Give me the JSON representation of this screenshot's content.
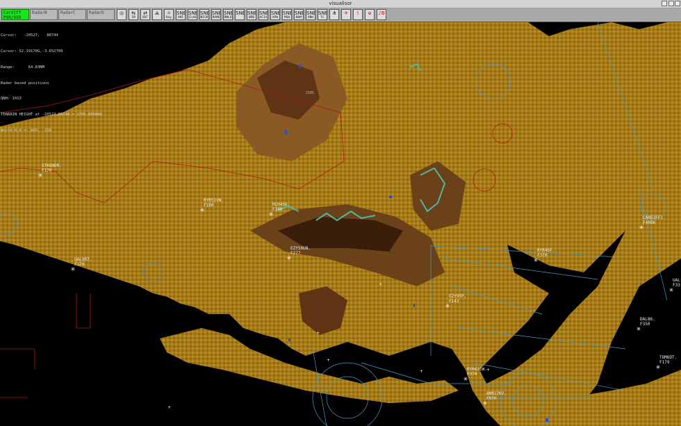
{
  "window": {
    "title": "visualisor"
  },
  "radar_tabs": [
    {
      "label": "Cardiff PSR/SSR",
      "active": true
    },
    {
      "label": "RadarB",
      "active": false
    },
    {
      "label": "RadarC",
      "active": false
    },
    {
      "label": "RadarD",
      "active": false
    }
  ],
  "tools": [
    {
      "label": "",
      "icon": "◎"
    },
    {
      "label": "IN",
      "icon": "⇆"
    },
    {
      "label": "OUT",
      "icon": "⇄"
    },
    {
      "label": "",
      "icon": "⟁"
    },
    {
      "label": "Day",
      "icon": "☼"
    },
    {
      "label": "AMI",
      "icon": "SNET"
    },
    {
      "label": "CLAU",
      "icon": "SNET"
    },
    {
      "label": "NIGR",
      "icon": "SNET"
    },
    {
      "label": "RAMD",
      "icon": "SNET"
    },
    {
      "label": "RMLD",
      "icon": "SNET"
    },
    {
      "label": "",
      "icon": "SNET"
    },
    {
      "label": "WRB",
      "icon": "SNET"
    },
    {
      "label": "AFIA",
      "icon": "SNET"
    },
    {
      "label": "APW",
      "icon": "SNET"
    },
    {
      "label": "MSW",
      "icon": "SNET"
    },
    {
      "label": "NAM",
      "icon": "SNET"
    },
    {
      "label": "ONH",
      "icon": "SNET"
    },
    {
      "label": "TC",
      "icon": "SNET"
    },
    {
      "label": "",
      "icon": "⋔"
    },
    {
      "label": "",
      "icon": "✈"
    },
    {
      "label": "",
      "icon": "⌇"
    },
    {
      "label": "",
      "icon": "ⱺ"
    },
    {
      "label": "",
      "icon": "♪B"
    }
  ],
  "info_lines": [
    "Cursor:   -20527,   88744",
    "Cursor: 52.19170G,-3.652709",
    "Range:      64.83NM",
    "Radar based positions",
    "QNH: 1013",
    "TERRAIN HEIGHT at -20527,88744 = 1705.000000",
    "World 0,0 =: 869,  210"
  ],
  "aircraft": [
    {
      "callsign": "STK80DR.",
      "level": "F170"
    },
    {
      "callsign": "RYR51VN.",
      "level": "F160"
    },
    {
      "callsign": "RCH456.",
      "level": "F380"
    },
    {
      "callsign": "EZY58UN.",
      "level": "F277"
    },
    {
      "callsign": "UAL907.",
      "level": "F370"
    },
    {
      "callsign": "RYR45F.",
      "level": "F370"
    },
    {
      "callsign": "EZY9YP.",
      "level": "F143"
    },
    {
      "callsign": "CARDIFF1",
      "level": "F4086"
    },
    {
      "callsign": "DAL86.",
      "level": "F350"
    },
    {
      "callsign": "TOM6DT.",
      "level": "F179"
    },
    {
      "callsign": "RYR631W.",
      "level": "F370"
    },
    {
      "callsign": "BMR17KV.",
      "level": "F070"
    },
    {
      "callsign": "UAL",
      "level": "F33"
    }
  ],
  "map_labels": {
    "peak": "2105"
  },
  "colors": {
    "active_tab": "#19e619",
    "land": "#a07a1a",
    "sea": "#000000",
    "airspace": "#5ab0d8",
    "sector": "#b01818"
  }
}
